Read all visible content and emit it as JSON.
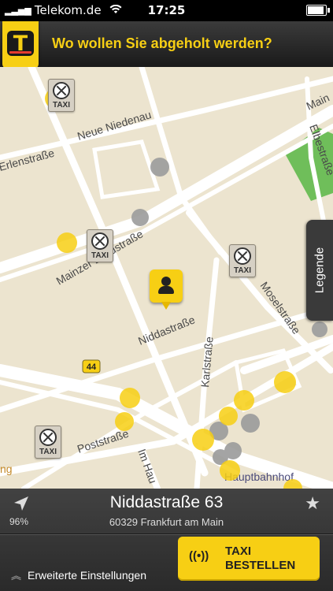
{
  "status_bar": {
    "carrier": "Telekom.de",
    "time": "17:25"
  },
  "header": {
    "prompt": "Wo wollen Sie abgeholt werden?"
  },
  "map": {
    "streets": [
      "Neue Niedenau",
      "Erlenstraße",
      "Mainzer Landstraße",
      "Niddastraße",
      "Moselstraße",
      "Karlstraße",
      "Poststraße",
      "Im Hau",
      "Elbestraße",
      "Main",
      "Hauptbahnhof",
      "44",
      "ng"
    ],
    "taxi_label": "TAXI",
    "legend_label": "Legende"
  },
  "location": {
    "accuracy": "96%",
    "street": "Niddastraße 63",
    "city": "60329 Frankfurt am Main"
  },
  "footer": {
    "settings_label": "Erweiterte Einstellungen",
    "order_line1": "TAXI",
    "order_line2": "BESTELLEN"
  },
  "colors": {
    "accent": "#f7cf14",
    "map_bg": "#ece4cf",
    "park": "#6fbe5a"
  }
}
